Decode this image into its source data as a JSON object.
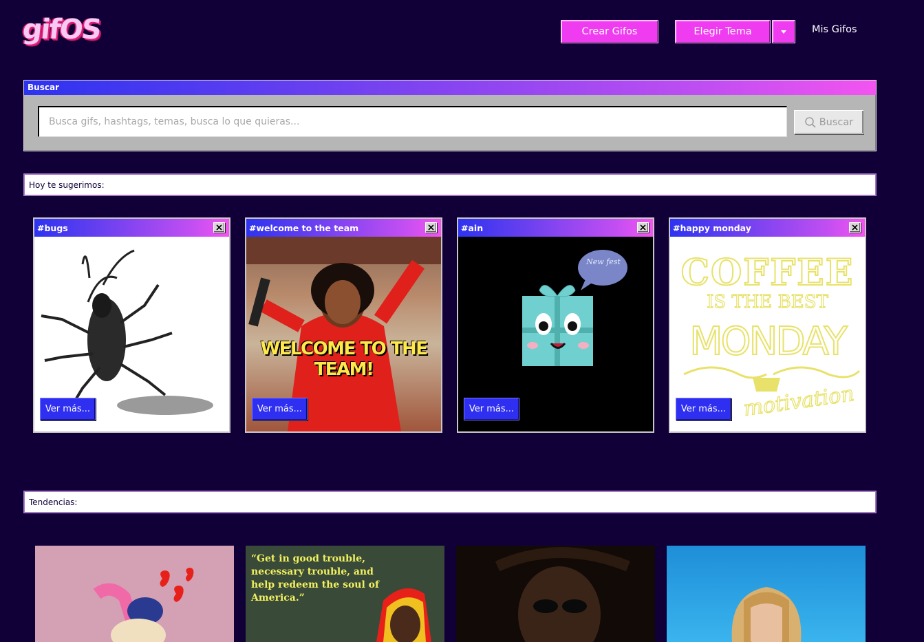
{
  "header": {
    "logo_text": "gifOS",
    "crear_label": "Crear Gifos",
    "tema_label": "Elegir Tema",
    "mis_gifos_label": "Mis Gifos"
  },
  "search": {
    "title": "Buscar",
    "placeholder": "Busca gifs, hashtags, temas, busca lo que quieras...",
    "value": "",
    "button_label": "Buscar"
  },
  "suggestions": {
    "heading": "Hoy te sugerimos:",
    "cards": [
      {
        "tag": "#bugs",
        "button": "Ver más..."
      },
      {
        "tag": "#welcome to the team",
        "button": "Ver más...",
        "caption": "WELCOME TO THE TEAM!"
      },
      {
        "tag": "#ain",
        "button": "Ver más...",
        "bubble": "New fest"
      },
      {
        "tag": "#happy monday",
        "button": "Ver más...",
        "line1": "COFFEE",
        "line2": "IS THE BEST",
        "line3": "MONDAY",
        "line4": "motivation"
      }
    ]
  },
  "trends": {
    "heading": "Tendencias:",
    "quote": "“Get in good trouble, necessary trouble, and help redeem the soul of America.”"
  },
  "colors": {
    "background": "#110038",
    "accent_pink": "#f03cf0",
    "accent_blue": "#2e2ff0"
  }
}
